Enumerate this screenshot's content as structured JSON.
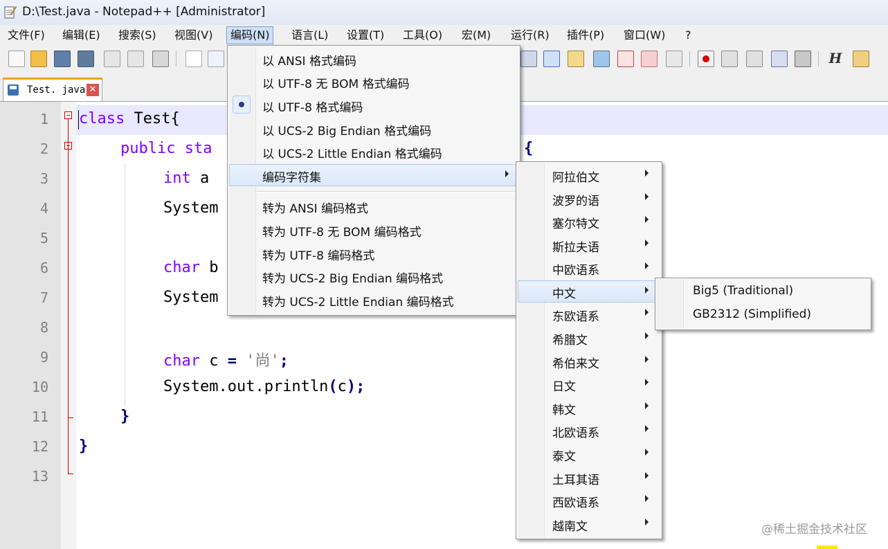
{
  "window": {
    "title": "D:\\Test.java - Notepad++ [Administrator]"
  },
  "menubar": {
    "items": [
      "文件(F)",
      "编辑(E)",
      "搜索(S)",
      "视图(V)",
      "编码(N)",
      "语言(L)",
      "设置(T)",
      "工具(O)",
      "宏(M)",
      "运行(R)",
      "插件(P)",
      "窗口(W)",
      "?"
    ],
    "active": "编码(N)"
  },
  "tab": {
    "label": "Test. java",
    "close": "✕"
  },
  "editor": {
    "line_numbers": [
      "1",
      "2",
      "3",
      "4",
      "5",
      "6",
      "7",
      "8",
      "9",
      "10",
      "11",
      "12",
      "13"
    ],
    "lines": [
      {
        "l1": "class",
        "l2": " Test{"
      },
      {
        "l1": "public sta",
        "l2": "",
        "tail": "{"
      },
      {
        "l1": "int",
        "l2": " a"
      },
      {
        "l1": "System",
        "l2": ""
      },
      {
        "l1": "",
        "l2": ""
      },
      {
        "l1": "char",
        "l2": " b"
      },
      {
        "l1": "System",
        "l2": ""
      },
      {
        "l1": "",
        "l2": ""
      },
      {
        "l1": "char",
        "l2": " c ",
        "op": "=",
        "str": " '尚'",
        "end": ";"
      },
      {
        "l1": "System.out.println",
        "op": "(",
        "l2": "c",
        "op2": ")",
        "end": ";"
      },
      {
        "l1": "}"
      },
      {
        "l1": "}"
      },
      {
        "l1": ""
      }
    ]
  },
  "encoding_menu": {
    "items": [
      "以 ANSI 格式编码",
      "以 UTF-8 无 BOM 格式编码",
      "以 UTF-8 格式编码",
      "以 UCS-2 Big Endian 格式编码",
      "以 UCS-2 Little Endian 格式编码",
      "编码字符集",
      "转为 ANSI 编码格式",
      "转为 UTF-8 无 BOM 编码格式",
      "转为 UTF-8 编码格式",
      "转为 UCS-2 Big Endian 编码格式",
      "转为 UCS-2 Little Endian 编码格式"
    ],
    "checked": "以 UTF-8 格式编码",
    "highlighted": "编码字符集"
  },
  "charset_menu": {
    "items": [
      "阿拉伯文",
      "波罗的语",
      "塞尔特文",
      "斯拉夫语",
      "中欧语系",
      "中文",
      "东欧语系",
      "希腊文",
      "希伯来文",
      "日文",
      "韩文",
      "北欧语系",
      "泰文",
      "土耳其语",
      "西欧语系",
      "越南文"
    ],
    "highlighted": "中文"
  },
  "chinese_menu": {
    "items": [
      "Big5 (Traditional)",
      "GB2312 (Simplified)"
    ]
  },
  "watermark": "@稀土掘金技术社区"
}
